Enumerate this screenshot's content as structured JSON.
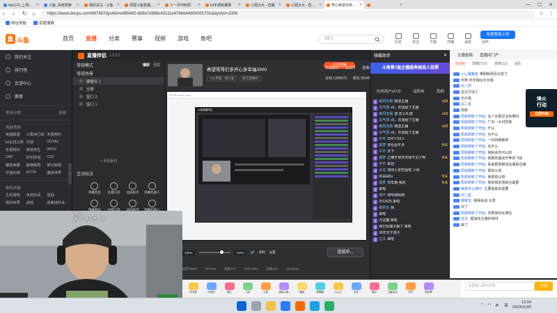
{
  "browser": {
    "tabs": [
      {
        "title": "hao123_上网从这里开始",
        "color": "#2e7bf6",
        "active": false
      },
      {
        "title": "斗鱼_百度搜索",
        "color": "#2e7bf6",
        "active": false
      },
      {
        "title": "我的关注 - 斗鱼",
        "color": "#ff6a00",
        "active": false
      },
      {
        "title": "周围斗鱼直播_周边斗鱼直...",
        "color": "#ff6a00",
        "active": false
      },
      {
        "title": "十一月冲刺周",
        "color": "#ff6a00",
        "active": false
      },
      {
        "title": "lol手游斩暑赛",
        "color": "#ff6a00",
        "active": false
      },
      {
        "title": "小砚大大 - 直播",
        "color": "#ff6a00",
        "active": false
      },
      {
        "title": "小砚大大 - 直播 小砚大大...",
        "color": "#ff6a00",
        "active": false
      },
      {
        "title": "芳心纵放手碎亮直播_斗...",
        "color": "#ff6a00",
        "active": true
      },
      {
        "title": "",
        "color": "#ff6a00",
        "active": false
      }
    ],
    "url": "https://www.douyu.com/667487dyshid=e985400-b58e7d586c42c11e474bb44b00001701&dyshci=1008",
    "bookmarks": [
      "网址导航",
      "百度搜索"
    ]
  },
  "site": {
    "logo": "斗鱼",
    "nav": [
      "首页",
      "直播",
      "分类",
      "赛事",
      "视频",
      "游戏",
      "鱼吧"
    ],
    "nav_active": 1,
    "search_placeholder": "I线人",
    "header_icons": [
      "历史",
      "关注",
      "下载",
      "开播",
      "消息",
      "创作"
    ],
    "upload_button": "免费登录上传"
  },
  "sidebar": {
    "top_items": [
      "我的关注",
      "排行榜",
      "页游中心",
      "赛事"
    ],
    "cat_title": "常用分类",
    "cat_more": "全部",
    "section1_title": "网游竞技",
    "section1_items": [
      "英雄联盟",
      "三角洲行动",
      "无畏契约",
      "lol云顶之弈",
      "问道",
      "DOTA2",
      "无畏契约",
      "绝地求生",
      "APEX",
      "DNF",
      "炉石传说",
      "CS2",
      "魔兽争霸",
      "巅峰极限",
      "梦幻西游",
      "守望先锋",
      "DOTA",
      "魔兽世界"
    ],
    "section2_title": "单机热游",
    "section2_items": [
      "主机游戏",
      "永劫无间",
      "逆战",
      "我的世界",
      "战地",
      "逃离塔科夫"
    ]
  },
  "app": {
    "name": "直播伴侣",
    "version": "1.3.3.2",
    "scene_title": "常规模式",
    "scene_tabs": [
      "横屏",
      "竖屏"
    ],
    "scene_header": "常规场景",
    "scenes": [
      "摄像头 1",
      "全屏",
      "窗口 2",
      "窗口 1"
    ],
    "add_source": "+ 添加素材",
    "interact_title": "互动玩法",
    "interact_items": [
      "弹幕回放",
      "主播口袋",
      "动画助手",
      "弹幕机器人",
      "弹幕网站",
      "主播口袋",
      "动画助手",
      "弹幕机器人"
    ],
    "stream_title": "希望哥哥们多开心多幸福3300",
    "tags": [
      "LOL英雄 - 格斗城",
      "恩兰直播间"
    ],
    "live_badge": "正在直播",
    "stats": [
      "开播提示",
      "房间号",
      "直播推流"
    ],
    "stats2": [
      "在线 1345679",
      "禁言 85345"
    ],
    "bottom_pct": [
      "100%",
      "100%"
    ],
    "bottom_labels": [
      "伴奏",
      "麦克风",
      "录制",
      "设置"
    ],
    "connect": "连接中...",
    "status": [
      "码率:0kb/s",
      "FPS:60",
      "帧数:0%",
      "CPU:28%",
      "丢帧:0%",
      "00:00:00"
    ],
    "inner_title": "斗鱼直播伴侣"
  },
  "danmu": {
    "title": "弹幕助手",
    "banner": "斗鱼第7届主播盛典候选人投票",
    "tabs": [
      "在线用户(473)",
      "话粉丝",
      "贴粉"
    ],
    "rows": [
      {
        "lv": "8",
        "name": "南风无我",
        "text": "赠送主播",
        "gift": "x10"
      },
      {
        "lv": "3",
        "name": "白气球",
        "text": "x5，并送给了主播",
        "gift": ""
      },
      {
        "lv": "8",
        "name": "南风无我",
        "text": "送 爱心礼炮",
        "gift": "x10"
      },
      {
        "lv": "3",
        "name": "白气球",
        "text": "x5，并送给了主播",
        "gift": ""
      },
      {
        "lv": "8",
        "name": "南风无我",
        "text": "赠送主播",
        "gift": "x10"
      },
      {
        "lv": "3",
        "name": "白气球",
        "text": "x5，并送给了主播",
        "gift": ""
      },
      {
        "lv": "6",
        "name": "平平",
        "text": "224个/15人",
        "gift": ""
      },
      {
        "lv": "6",
        "name": "孤梦",
        "text": "你也是不多",
        "gift": "H.E"
      },
      {
        "lv": "6",
        "name": "平平",
        "text": "天下",
        "gift": ""
      },
      {
        "lv": "6",
        "name": "孤梦",
        "text": "之痛不你天天就不见了啊",
        "gift": "H.E"
      },
      {
        "lv": "6",
        "name": "平平",
        "text": "来自",
        "gift": ""
      },
      {
        "lv": "4",
        "name": "大宝",
        "text": "你的小爱吃饭啦 小米",
        "gift": ""
      },
      {
        "lv": "4",
        "name": "",
        "text": "的哥哥吗",
        "gift": "H.E"
      },
      {
        "lv": "6",
        "name": "孤梦",
        "text": "无年期 我的",
        "gift": "H.E"
      },
      {
        "lv": "5",
        "name": "",
        "text": "来啦",
        "gift": ""
      },
      {
        "lv": "8",
        "name": "双叶",
        "text": "双呼我呢啊",
        "gift": ""
      },
      {
        "lv": "3",
        "name": "",
        "text": "日11625 来啦",
        "gift": ""
      },
      {
        "lv": "6",
        "name": "南风无",
        "text": "我",
        "gift": ""
      },
      {
        "lv": "5",
        "name": "",
        "text": "来啦",
        "gift": ""
      },
      {
        "lv": "5",
        "name": "",
        "text": "元宝糖 来啦",
        "gift": ""
      },
      {
        "lv": "5",
        "name": "",
        "text": "殇已机械子解了 来啦",
        "gift": ""
      },
      {
        "lv": "5",
        "name": "",
        "text": "30岁天才弟子",
        "gift": ""
      },
      {
        "lv": "5",
        "name": "辽江",
        "text": "来啦",
        "gift": ""
      }
    ]
  },
  "right": {
    "tabs": [
      "主播投稿",
      "直播间门户"
    ],
    "subtabs": [
      "活动榜",
      "周榜(713)",
      "贵族(13)",
      "战队"
    ],
    "ad_text": [
      "烽火",
      "行动"
    ],
    "ad_cta": "立即开始",
    "chat": [
      {
        "name": "小心翼翼走",
        "text": "带刷新网页出发了"
      },
      {
        "name": "",
        "text": "可称·年年相识大长城"
      },
      {
        "name": "白二的",
        "text": ""
      },
      {
        "name": "",
        "text": "这次行动了"
      },
      {
        "name": "",
        "text": "乐乐啦"
      },
      {
        "name": "白二星",
        "text": ""
      },
      {
        "name": "",
        "text": "收获"
      },
      {
        "name": "阳泉刷新了开始:",
        "text": "在广东那应没有着吗"
      },
      {
        "name": "阳泉刷新了开始:",
        "text": "广东一大村同家"
      },
      {
        "name": "阳泉刷新了开始:",
        "text": "不认"
      },
      {
        "name": "阳泉刷新了开始:",
        "text": "也不认"
      },
      {
        "name": "阳泉刷新了开始:",
        "text": "一村的韩斯校"
      },
      {
        "name": "阳泉刷新了开始:",
        "text": "也不认"
      },
      {
        "name": "阳泉刷新了开始:",
        "text": "我就会你可以的"
      },
      {
        "name": "阳泉刷新了开始:",
        "text": "我那的最完开奔的飞快"
      },
      {
        "name": "阳泉刷新了开始:",
        "text": "看来帮我那段在嘴看在嘴"
      },
      {
        "name": "阳泉刷新了开始:",
        "text": "很有认知"
      },
      {
        "name": "阳泉刷新了开始:",
        "text": "我很有认知"
      },
      {
        "name": "阳泉刷新了开始:",
        "text": "我前我定我综合最重"
      },
      {
        "name": "美梁传公准中:",
        "text": "主要需看你需要"
      },
      {
        "name": "白二星",
        "text": ""
      },
      {
        "name": "嗯嗯宝:",
        "text": "我得会话 大发"
      },
      {
        "name": "",
        "text": "次了"
      },
      {
        "name": "阳泉刷新了开始:",
        "text": "无限身材太棒在"
      },
      {
        "name": "在往·",
        "text": "超级欢主播好身材"
      },
      {
        "name": "",
        "text": "来了"
      }
    ],
    "chat_placeholder": "这里输入聊天内容",
    "send": "发送"
  },
  "gifts": [
    "荧光棒",
    "大宝剑",
    "爱心",
    "飞机",
    "火箭",
    "超级火箭",
    "喵喵",
    "棒棒糖",
    "小心心",
    "礼花",
    "魔法",
    "主播加油",
    "守护",
    "粉丝牌",
    "告白",
    "宝箱",
    "闪电",
    "幸运卡",
    "星星",
    "盛典"
  ],
  "taskbar": {
    "time": "12:24",
    "date": "2023/11/20",
    "lang": "英"
  },
  "cam_caption": [
    "惠人:",
    "惠人: 繁华哥，胖"
  ]
}
